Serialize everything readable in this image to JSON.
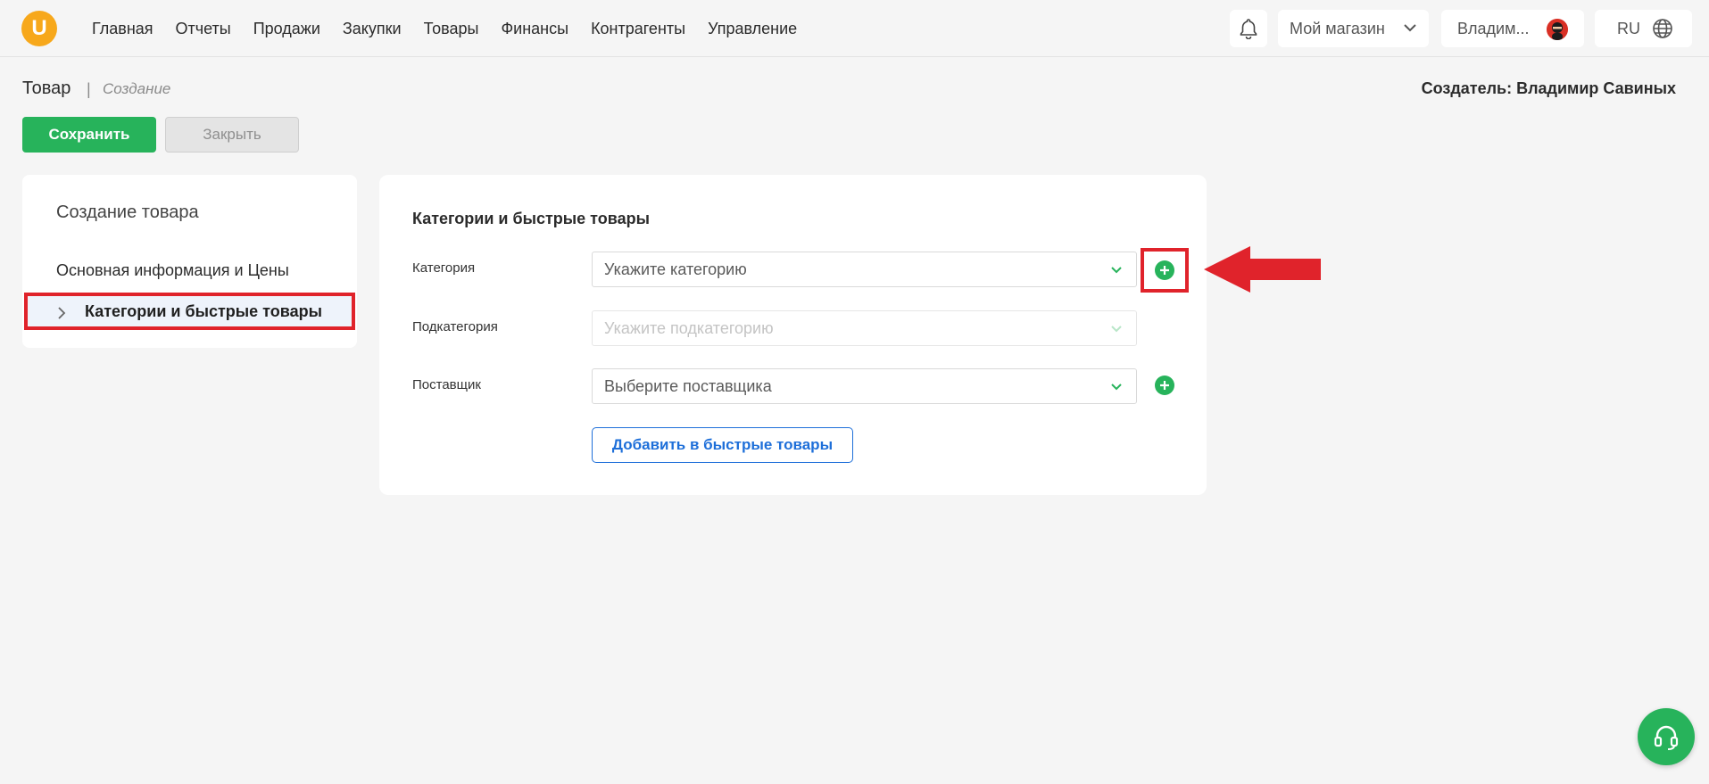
{
  "header": {
    "logo_letter": "U",
    "nav": [
      "Главная",
      "Отчеты",
      "Продажи",
      "Закупки",
      "Товары",
      "Финансы",
      "Контрагенты",
      "Управление"
    ],
    "store": "Мой магазин",
    "user": "Владим...",
    "lang": "RU"
  },
  "page": {
    "title": "Товар",
    "separator": "|",
    "subtitle": "Создание",
    "creator": "Создатель: Владимир Савиных",
    "save_label": "Сохранить",
    "close_label": "Закрыть"
  },
  "sidebar": {
    "title": "Создание товара",
    "items": [
      {
        "label": "Основная информация и Цены"
      },
      {
        "label": "Категории и быстрые товары",
        "active": true
      }
    ]
  },
  "form": {
    "heading": "Категории и быстрые товары",
    "fields": [
      {
        "label": "Категория",
        "placeholder": "Укажите категорию"
      },
      {
        "label": "Подкатегория",
        "placeholder": "Укажите подкатегорию",
        "disabled": true
      },
      {
        "label": "Поставщик",
        "placeholder": "Выберите поставщика"
      }
    ],
    "quick_button": "Добавить в быстрые товары"
  },
  "colors": {
    "accent_green": "#27b35b",
    "link_blue": "#1e6fd9",
    "highlight_red": "#e0232b",
    "logo_orange": "#f7a81b"
  },
  "icons": [
    "bell-icon",
    "chevron-down-icon",
    "avatar",
    "globe-icon",
    "chevron-right-icon",
    "plus-circle-icon",
    "headset-icon",
    "arrow-annotation"
  ]
}
